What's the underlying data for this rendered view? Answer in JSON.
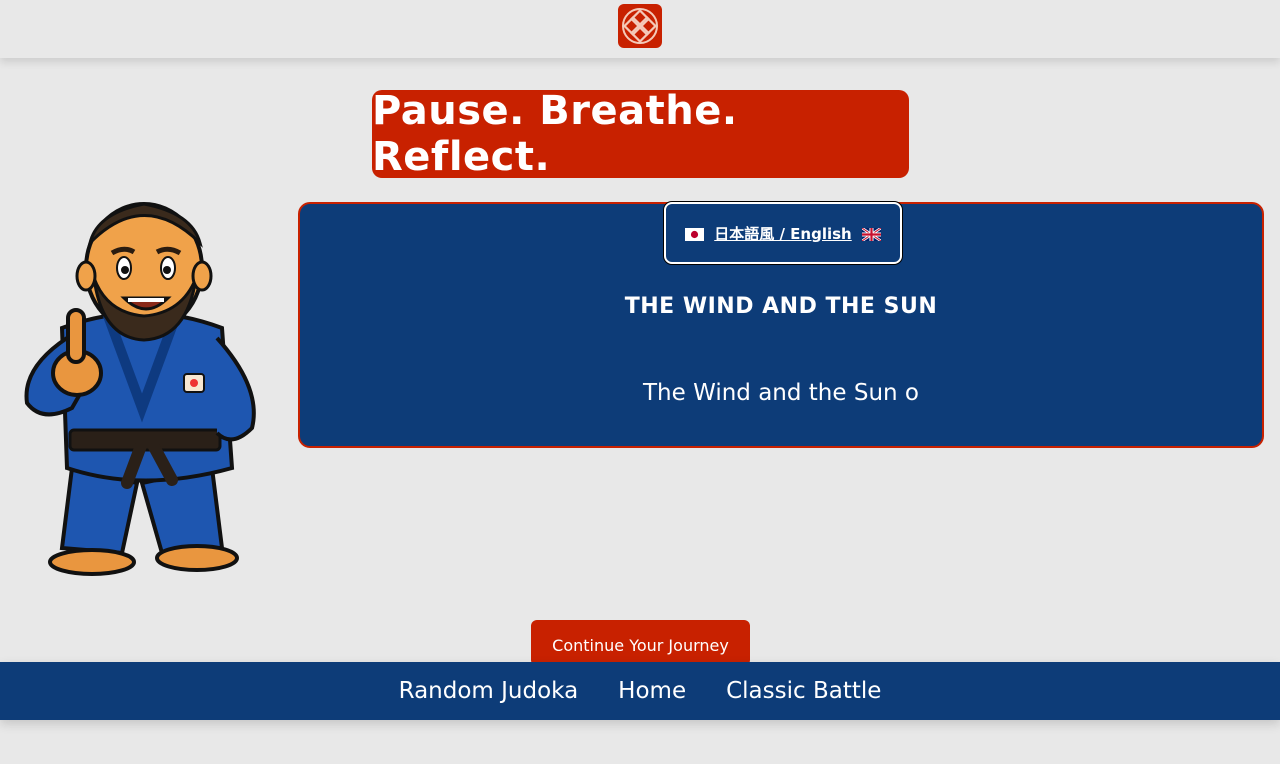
{
  "header": {
    "logo_icon": "knot-logo-icon",
    "logo_color": "#c82100"
  },
  "banner": {
    "title": "Pause. Breathe. Reflect."
  },
  "mascot": {
    "icon": "judoka-mascot-icon"
  },
  "story_card": {
    "language_toggle": {
      "label": "日本語風 / English",
      "left_flag": "japan-flag-icon",
      "right_flag": "uk-flag-icon"
    },
    "title": "THE WIND AND THE SUN",
    "text": "The Wind and the Sun o"
  },
  "actions": {
    "continue_label": "Continue Your Journey"
  },
  "bottom_nav": {
    "items": [
      {
        "label": "Random Judoka"
      },
      {
        "label": "Home"
      },
      {
        "label": "Classic Battle"
      }
    ]
  },
  "colors": {
    "accent_red": "#c82100",
    "navy": "#0d3c78",
    "background": "#e8e8e8"
  }
}
